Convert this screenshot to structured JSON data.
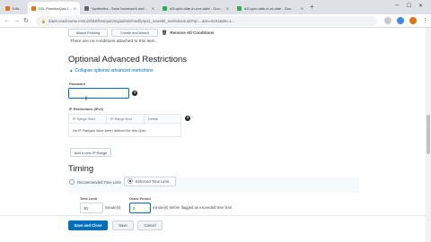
{
  "browser": {
    "tabs": [
      {
        "title": "Edit Quiz",
        "active": false
      },
      {
        "title": "D2L PracticeQuiz Intro - ...",
        "active": true
      },
      {
        "title": "Synthetics - Save homework and...",
        "active": false
      },
      {
        "title": "d2l-quiz-date-in-one-date - Goo...",
        "active": false
      },
      {
        "title": "d2l-quiz-date-in-ul-date - Goo...",
        "active": false
      }
    ],
    "url": "dawn.readcourse.instr.d2l/d2l/lms/quizzing/admin/modify/quiz_newedit_restrictions.d2l?qi=...&ou=6151&dts=1..."
  },
  "conditions": {
    "attach_button": "Attach Existing",
    "create_button": "Create and Attach",
    "remove_all": "Remove All Conditions",
    "empty_text": "There are no conditions attached to this item."
  },
  "optional_restrictions": {
    "heading": "Optional Advanced Restrictions",
    "collapse_link": "Collapse optional advanced restrictions",
    "password_label": "Password",
    "password_value": "",
    "ip_label": "IP Restrictions (IPv4)",
    "ip_columns": [
      "IP Range Start",
      "IP Range End",
      "Delete"
    ],
    "ip_empty": "No IP Ranges have been defined for this Quiz.",
    "add_ip_button": "Add a new IP Range"
  },
  "timing": {
    "heading": "Timing",
    "recommended_label": "Recommended Time Limit",
    "enforced_label": "Enforced Time Limit",
    "time_limit_label": "Time Limit",
    "time_limit_value": "30",
    "time_limit_unit": "minute(s)",
    "grace_label": "Grace Period",
    "grace_value": "2",
    "grace_suffix": "minute(s) before flagged as exceeded time limit"
  },
  "footer": {
    "save_close": "Save and Close",
    "save": "Save",
    "cancel": "Cancel"
  },
  "colors": {
    "primary": "#006fbf",
    "chrome_bg": "#dee1e6",
    "timing_panel": "#f5fbfd"
  }
}
